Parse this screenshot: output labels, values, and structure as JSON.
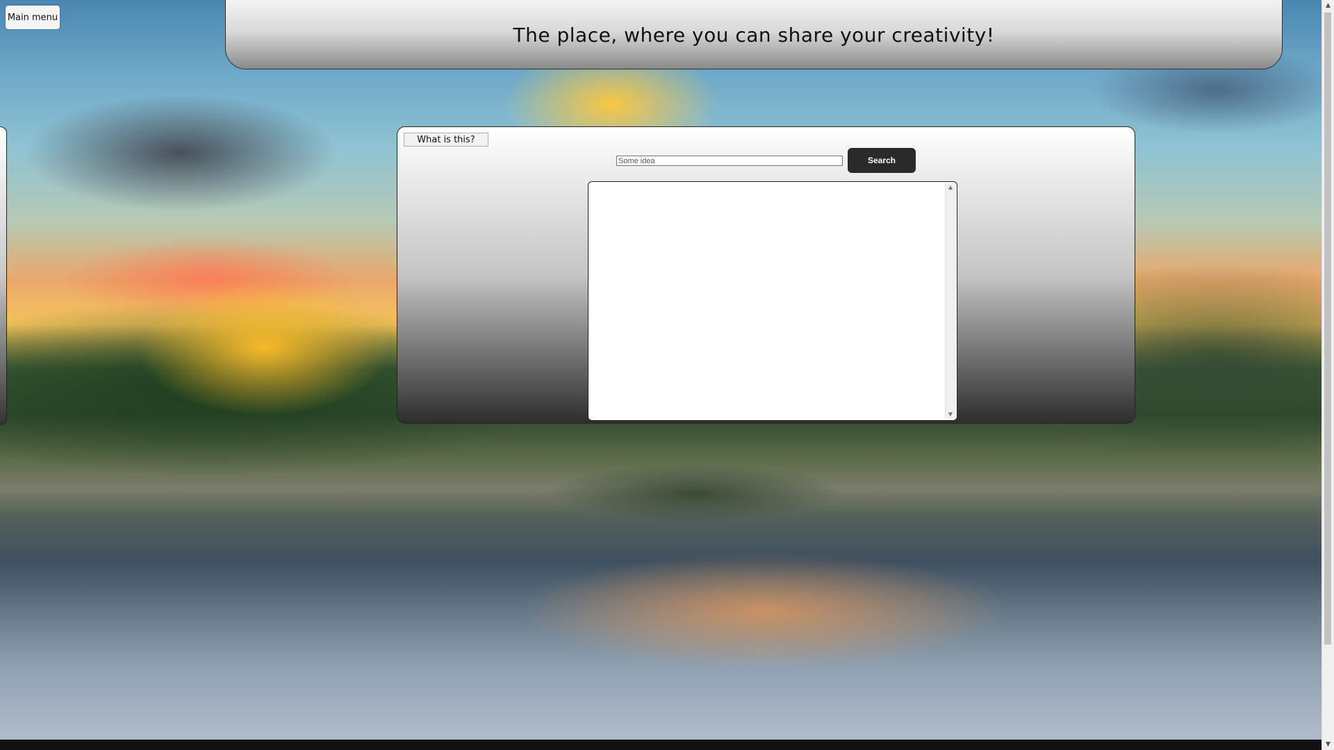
{
  "header": {
    "title": "The place, where you can share your creativity!"
  },
  "nav": {
    "main_menu_label": "Main menu"
  },
  "panel": {
    "info_button_label": "What is this?",
    "search": {
      "placeholder": "Some idea",
      "value": "",
      "button_label": "Search"
    },
    "results": {
      "items": []
    }
  },
  "icons": {
    "scroll_up": "▲",
    "scroll_down": "▼"
  },
  "colors": {
    "search_button": "#2a2a2a",
    "panel_gradient_top": "#ffffff",
    "panel_gradient_bottom": "#2d2d2d"
  }
}
